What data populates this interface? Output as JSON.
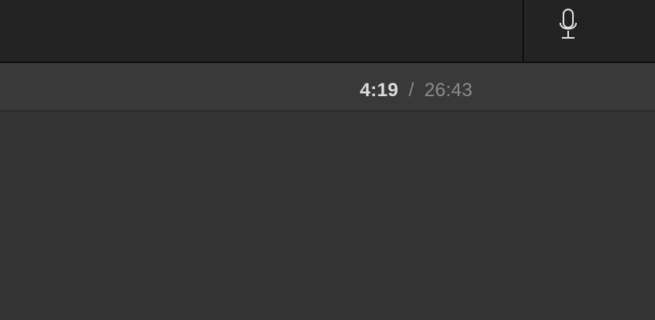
{
  "toolbar": {
    "mic_icon": "microphone-icon"
  },
  "playback": {
    "current_time": "4:19",
    "separator": "/",
    "total_time": "26:43"
  },
  "colors": {
    "top_bar": "#232323",
    "time_bar": "#393939",
    "content": "#353535",
    "current_time_text": "#dcdcdc",
    "secondary_text": "#8a8a8a"
  }
}
